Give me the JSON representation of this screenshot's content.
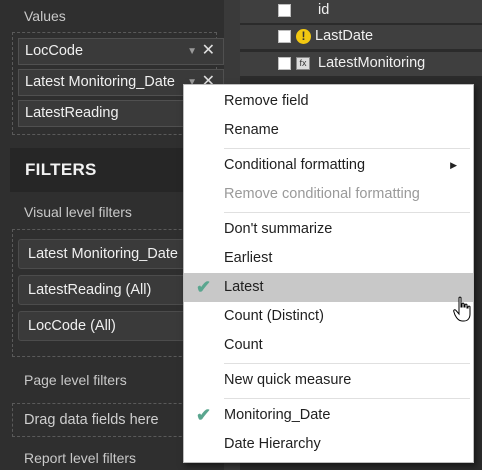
{
  "values_section": {
    "label": "Values",
    "wells": [
      {
        "label": "LocCode",
        "icon_chevron": "chevron-down-icon",
        "icon_close": "close-icon"
      },
      {
        "label": "Latest Monitoring_Date",
        "icon_chevron": "chevron-down-icon",
        "icon_close": "close-icon"
      },
      {
        "label": "LatestReading"
      }
    ]
  },
  "filters": {
    "header": "FILTERS",
    "visual_level_label": "Visual level filters",
    "visual_filters": [
      {
        "label": "Latest Monitoring_Date"
      },
      {
        "label": "LatestReading  (All)"
      },
      {
        "label": "LocCode  (All)"
      }
    ],
    "page_level_label": "Page level filters",
    "drop_zone_text": "Drag data fields here",
    "report_level_label": "Report level filters"
  },
  "fields": [
    {
      "label": "id",
      "icon": null
    },
    {
      "label": "LastDate",
      "icon": "warning-icon"
    },
    {
      "label": "LatestMonitoring",
      "icon": "measure-icon"
    }
  ],
  "context_menu": {
    "items": [
      {
        "label": "Remove field"
      },
      {
        "label": "Rename"
      },
      {
        "label": "Conditional formatting",
        "submenu": true
      },
      {
        "label": "Remove conditional formatting",
        "disabled": true
      },
      {
        "label": "Don't summarize"
      },
      {
        "label": "Earliest"
      },
      {
        "label": "Latest",
        "checked": true,
        "hovered": true
      },
      {
        "label": "Count (Distinct)"
      },
      {
        "label": "Count"
      },
      {
        "label": "New quick measure"
      },
      {
        "label": "Monitoring_Date",
        "checked": true
      },
      {
        "label": "Date Hierarchy"
      }
    ],
    "check_glyph": "✔",
    "submenu_arrow": "▶"
  },
  "colors": {
    "check": "#5aa68f",
    "hover": "#c8c8c8",
    "warning": "#f2c811"
  }
}
